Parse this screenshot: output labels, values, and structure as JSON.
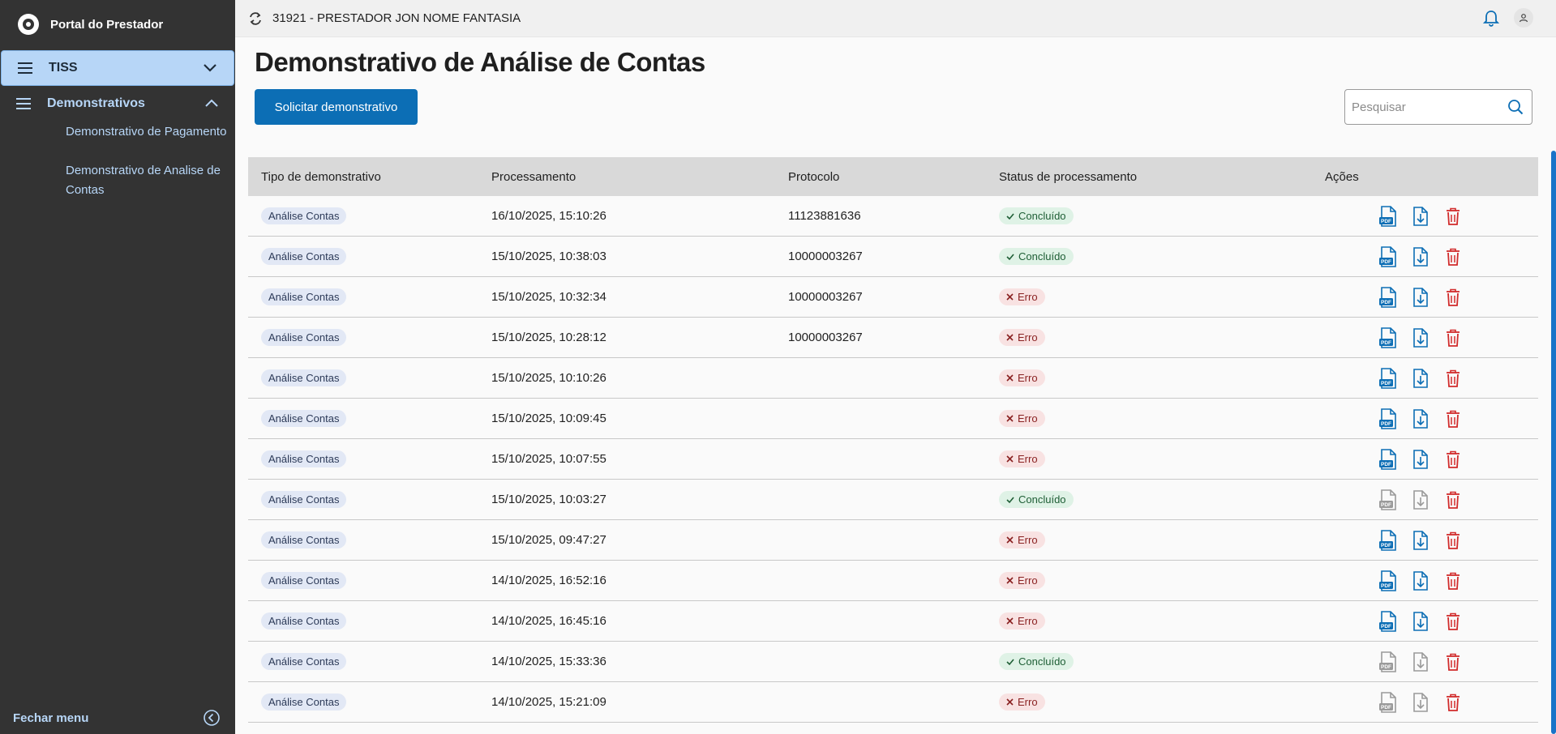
{
  "colors": {
    "sidebar_bg": "#333333",
    "accent": "#0c6eb5",
    "active_item": "#b7d6f7",
    "success": "#dff2e6",
    "error": "#f8e2e2",
    "delete": "#d12b2b"
  },
  "sidebar": {
    "brand": "Portal do Prestador",
    "tiss_label": "TISS",
    "section_label": "Demonstrativos",
    "items": [
      {
        "label": "Demonstrativo de Pagamento"
      },
      {
        "label": "Demonstrativo de Analise de Contas"
      }
    ],
    "footer_label": "Fechar menu"
  },
  "topbar": {
    "provider": "31921 - PRESTADOR JON NOME FANTASIA"
  },
  "page": {
    "title": "Demonstrativo de Análise de Contas",
    "primary_button": "Solicitar demonstrativo",
    "search_placeholder": "Pesquisar"
  },
  "table": {
    "columns": [
      "Tipo de demonstrativo",
      "Processamento",
      "Protocolo",
      "Status de processamento",
      "Ações"
    ],
    "rows": [
      {
        "tipo": "Análise Contas",
        "processamento": "16/10/2025, 15:10:26",
        "protocolo": "11123881636",
        "status": "Concluído",
        "status_kind": "ok",
        "enabled": true
      },
      {
        "tipo": "Análise Contas",
        "processamento": "15/10/2025, 10:38:03",
        "protocolo": "10000003267",
        "status": "Concluído",
        "status_kind": "ok",
        "enabled": true
      },
      {
        "tipo": "Análise Contas",
        "processamento": "15/10/2025, 10:32:34",
        "protocolo": "10000003267",
        "status": "Erro",
        "status_kind": "err",
        "enabled": true
      },
      {
        "tipo": "Análise Contas",
        "processamento": "15/10/2025, 10:28:12",
        "protocolo": "10000003267",
        "status": "Erro",
        "status_kind": "err",
        "enabled": true
      },
      {
        "tipo": "Análise Contas",
        "processamento": "15/10/2025, 10:10:26",
        "protocolo": "",
        "status": "Erro",
        "status_kind": "err",
        "enabled": true
      },
      {
        "tipo": "Análise Contas",
        "processamento": "15/10/2025, 10:09:45",
        "protocolo": "",
        "status": "Erro",
        "status_kind": "err",
        "enabled": true
      },
      {
        "tipo": "Análise Contas",
        "processamento": "15/10/2025, 10:07:55",
        "protocolo": "",
        "status": "Erro",
        "status_kind": "err",
        "enabled": true
      },
      {
        "tipo": "Análise Contas",
        "processamento": "15/10/2025, 10:03:27",
        "protocolo": "",
        "status": "Concluído",
        "status_kind": "ok",
        "enabled": false
      },
      {
        "tipo": "Análise Contas",
        "processamento": "15/10/2025, 09:47:27",
        "protocolo": "",
        "status": "Erro",
        "status_kind": "err",
        "enabled": true
      },
      {
        "tipo": "Análise Contas",
        "processamento": "14/10/2025, 16:52:16",
        "protocolo": "",
        "status": "Erro",
        "status_kind": "err",
        "enabled": true
      },
      {
        "tipo": "Análise Contas",
        "processamento": "14/10/2025, 16:45:16",
        "protocolo": "",
        "status": "Erro",
        "status_kind": "err",
        "enabled": true
      },
      {
        "tipo": "Análise Contas",
        "processamento": "14/10/2025, 15:33:36",
        "protocolo": "",
        "status": "Concluído",
        "status_kind": "ok",
        "enabled": false
      },
      {
        "tipo": "Análise Contas",
        "processamento": "14/10/2025, 15:21:09",
        "protocolo": "",
        "status": "Erro",
        "status_kind": "err",
        "enabled": false
      }
    ]
  }
}
